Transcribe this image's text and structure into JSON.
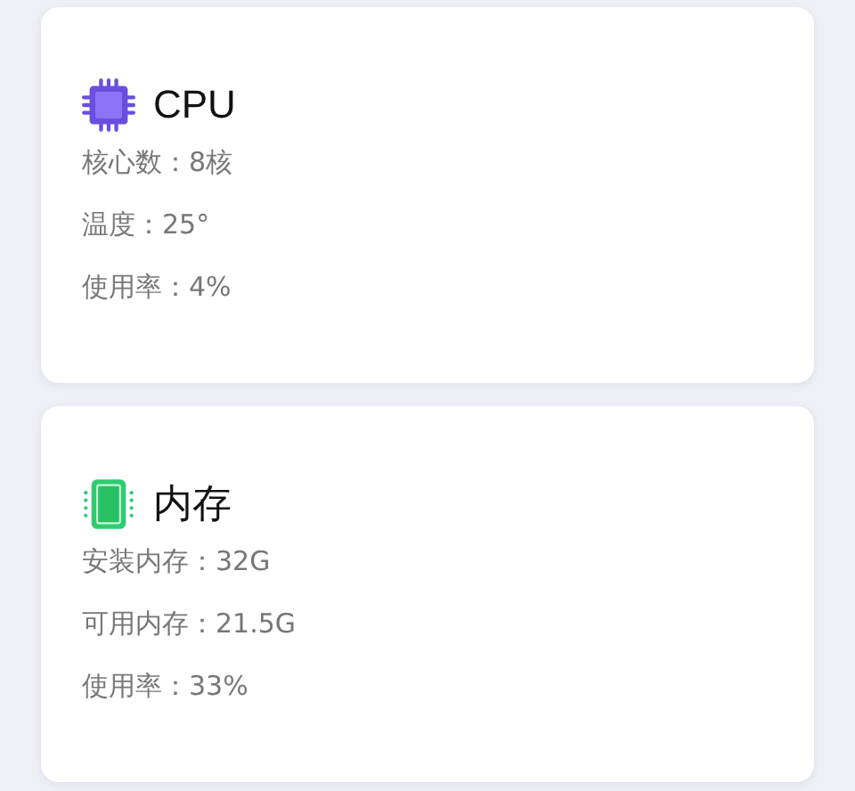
{
  "cards": [
    {
      "kind": "cpu",
      "title": "CPU",
      "rows": [
        "核心数：8核",
        "温度：25°",
        "使用率：4%"
      ]
    },
    {
      "kind": "memory",
      "title": "内存",
      "rows": [
        "安装内存：32G",
        "可用内存：21.5G",
        "使用率：33%"
      ]
    }
  ]
}
